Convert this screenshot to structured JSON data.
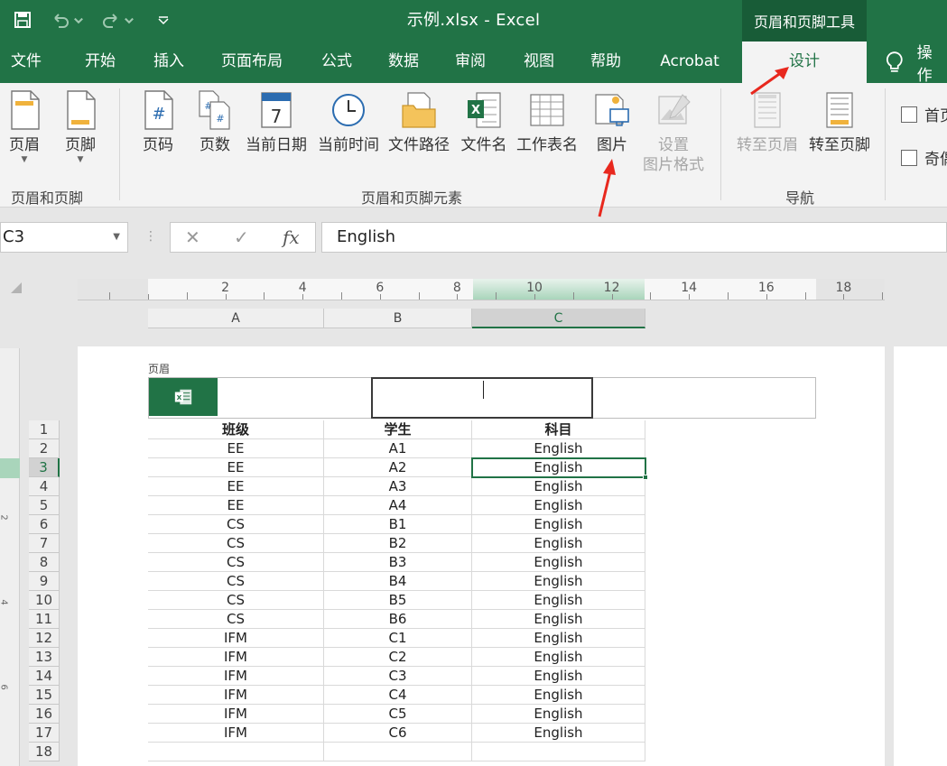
{
  "titlebar": {
    "title": "示例.xlsx  -  Excel",
    "context_tool": "页眉和页脚工具",
    "quick_access": [
      "save-icon",
      "undo-icon",
      "redo-icon",
      "customize-icon"
    ]
  },
  "tabs": [
    {
      "label": "文件"
    },
    {
      "label": "开始"
    },
    {
      "label": "插入"
    },
    {
      "label": "页面布局"
    },
    {
      "label": "公式"
    },
    {
      "label": "数据"
    },
    {
      "label": "审阅"
    },
    {
      "label": "视图"
    },
    {
      "label": "帮助"
    },
    {
      "label": "Acrobat"
    },
    {
      "label": "设计",
      "active": true
    }
  ],
  "tell_me": "操作",
  "ribbon": {
    "groups": [
      {
        "label": "页眉和页脚",
        "buttons": [
          "页眉",
          "页脚"
        ]
      },
      {
        "label": "页眉和页脚元素",
        "buttons": [
          "页码",
          "页数",
          "当前日期",
          "当前时间",
          "文件路径",
          "文件名",
          "工作表名",
          "图片",
          "设置\n图片格式"
        ]
      },
      {
        "label": "导航",
        "buttons": [
          "转至页眉",
          "转至页脚"
        ]
      }
    ],
    "options": [
      "首页",
      "奇偶"
    ]
  },
  "formula_bar": {
    "name_box": "C3",
    "content": "English"
  },
  "ruler": {
    "numbers": [
      "2",
      "4",
      "6",
      "8",
      "10",
      "12",
      "14",
      "16",
      "18"
    ]
  },
  "vruler": {
    "numbers": [
      "2",
      "4",
      "6"
    ]
  },
  "columns": [
    {
      "label": "A"
    },
    {
      "label": "B"
    },
    {
      "label": "C",
      "active": true
    }
  ],
  "page": {
    "header_label": "页眉"
  },
  "sheet": {
    "headers": [
      "班级",
      "学生",
      "科目"
    ],
    "rows": [
      [
        "EE",
        "A1",
        "English"
      ],
      [
        "EE",
        "A2",
        "English"
      ],
      [
        "EE",
        "A3",
        "English"
      ],
      [
        "EE",
        "A4",
        "English"
      ],
      [
        "CS",
        "B1",
        "English"
      ],
      [
        "CS",
        "B2",
        "English"
      ],
      [
        "CS",
        "B3",
        "English"
      ],
      [
        "CS",
        "B4",
        "English"
      ],
      [
        "CS",
        "B5",
        "English"
      ],
      [
        "CS",
        "B6",
        "English"
      ],
      [
        "IFM",
        "C1",
        "English"
      ],
      [
        "IFM",
        "C2",
        "English"
      ],
      [
        "IFM",
        "C3",
        "English"
      ],
      [
        "IFM",
        "C4",
        "English"
      ],
      [
        "IFM",
        "C5",
        "English"
      ],
      [
        "IFM",
        "C6",
        "English"
      ],
      [
        "",
        "",
        ""
      ]
    ],
    "row_numbers": [
      "1",
      "2",
      "3",
      "4",
      "5",
      "6",
      "7",
      "8",
      "9",
      "10",
      "11",
      "12",
      "13",
      "14",
      "15",
      "16",
      "17",
      "18"
    ],
    "active_row": "3",
    "active_cell": "C3"
  },
  "colors": {
    "excel_green": "#217346",
    "context_green": "#185c37",
    "annotation_red": "#e8281e"
  }
}
